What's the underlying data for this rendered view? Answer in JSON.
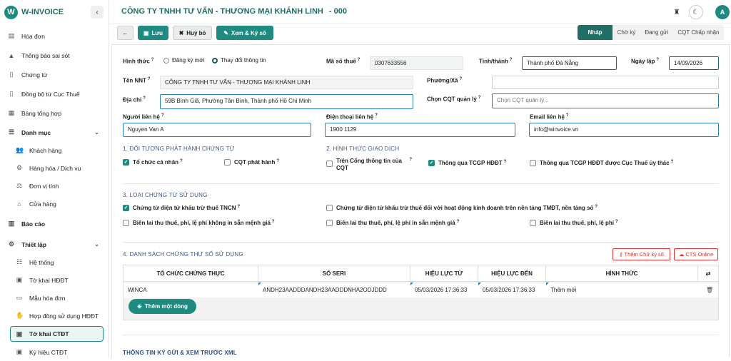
{
  "app": {
    "logo_letter": "W",
    "name": "W-INVOICE"
  },
  "sidebar": {
    "items": [
      {
        "label": "Hóa đơn",
        "icon": "invoice-icon"
      },
      {
        "label": "Thông báo sai sót",
        "icon": "warning-icon"
      },
      {
        "label": "Chứng từ",
        "icon": "document-icon"
      },
      {
        "label": "Đồng bộ từ Cục Thuế",
        "icon": "sync-document-icon"
      },
      {
        "label": "Bảng tổng hợp",
        "icon": "table-icon"
      },
      {
        "label": "Danh mục",
        "icon": "list-icon"
      },
      {
        "label": "Khách hàng",
        "icon": "users-icon"
      },
      {
        "label": "Hàng hóa / Dịch vụ",
        "icon": "goods-icon"
      },
      {
        "label": "Đơn vị tính",
        "icon": "scale-icon"
      },
      {
        "label": "Cửa hàng",
        "icon": "store-icon"
      },
      {
        "label": "Báo cáo",
        "icon": "report-icon"
      },
      {
        "label": "Thiết lập",
        "icon": "settings-icon"
      },
      {
        "label": "Hệ thống",
        "icon": "system-icon"
      },
      {
        "label": "Tờ khai HĐĐT",
        "icon": "form-icon"
      },
      {
        "label": "Mẫu hóa đơn",
        "icon": "template-icon"
      },
      {
        "label": "Hợp đồng sử dụng HĐĐT",
        "icon": "handshake-icon"
      },
      {
        "label": "Tờ khai CTĐT",
        "icon": "form-icon"
      },
      {
        "label": "Ký hiệu CTĐT",
        "icon": "form-icon"
      }
    ]
  },
  "header": {
    "company": "CÔNG TY TNHH TƯ VẤN - THƯƠNG MẠI KHÁNH LINH",
    "code": "- 000",
    "avatar": "A"
  },
  "toolbar": {
    "save": "Lưu",
    "cancel": "Huỷ bỏ",
    "view_sign": "Xem & Ký số",
    "steps": [
      "Nháp",
      "Chờ ký",
      "Đang gửi",
      "CQT Chấp nhận"
    ]
  },
  "form": {
    "hinh_thuc_label": "Hình thức",
    "radio_new": "Đăng ký mới",
    "radio_change": "Thay đổi thông tin",
    "mst_label": "Mã số thuế",
    "mst_value": "0307633556",
    "tinh_label": "Tỉnh/thành",
    "tinh_value": "Thành phố Đà Nẵng",
    "ngay_label": "Ngày lập",
    "ngay_value": "14/09/2026",
    "ten_label": "Tên NNT",
    "ten_value": "CÔNG TY TNHH TƯ VẤN - THƯƠNG MẠI KHÁNH LINH",
    "phuong_label": "Phường/Xã",
    "phuong_value": "",
    "diachi_label": "Địa chỉ",
    "diachi_value": "59B Bình Giã, Phường Tân Bình, Thành phố Hồ Chí Minh",
    "cqt_label": "Chọn CQT quản lý",
    "cqt_placeholder": "Chọn CQT quản lý...",
    "nguoi_label": "Người liên hệ",
    "nguoi_value": "Nguyen Van A",
    "dt_label": "Điện thoại liên hệ",
    "dt_value": "1900 1129",
    "email_label": "Email liên hệ",
    "email_value": "info@winvoice.vn"
  },
  "section1": {
    "title": "1. ĐỐI TƯỢNG PHÁT HÀNH CHỨNG TỪ",
    "to_chuc": "Tổ chức cá nhân",
    "cqt": "CQT phát hành"
  },
  "section2": {
    "title": "2. HÌNH THỨC GIAO DỊCH",
    "cong_tt": "Trên Cổng thông tin của CQT",
    "tcgp": "Thông qua TCGP HĐĐT",
    "tcgp_uy_thac": "Thông qua TCGP HĐĐT được Cục Thuế ủy thác"
  },
  "section3": {
    "title": "3. LOẠI CHỨNG TỪ SỬ DỤNG",
    "ct_tncn": "Chứng từ điện tử khấu trừ thuế TNCN",
    "ct_tmdt": "Chứng từ điện tử khấu trừ thuế đối với hoạt động kinh doanh trên nền tảng TMĐT, nền tảng số",
    "bl_khong": "Biên lai thu thuế, phí, lệ phí không in sẵn mệnh giá",
    "bl_in_san": "Biên lai thu thuế, phí, lệ phí in sẵn mệnh giá",
    "bl": "Biên lai thu thuế, phí, lệ phí"
  },
  "section4": {
    "title": "4. DANH SÁCH CHỨNG THƯ SỐ SỬ DỤNG",
    "add_signer": "Thêm Chữ ký số",
    "cts_online": "CTS Online",
    "columns": [
      "TỔ CHỨC CHỨNG THỰC",
      "SỐ SERI",
      "HIỆU LỰC TỪ",
      "HIỆU LỰC ĐẾN",
      "HÌNH THỨC"
    ],
    "rows": [
      [
        "WINCA",
        "ANDH23AADDDANDH23AADDDNHA2ODJDDD",
        "05/03/2026 17:36:33",
        "05/03/2026 17:36:33",
        "Thêm mới"
      ]
    ],
    "add_row": "Thêm một dòng"
  },
  "footer_section": "THÔNG TIN KÝ GỬI & XEM TRƯỚC XML"
}
